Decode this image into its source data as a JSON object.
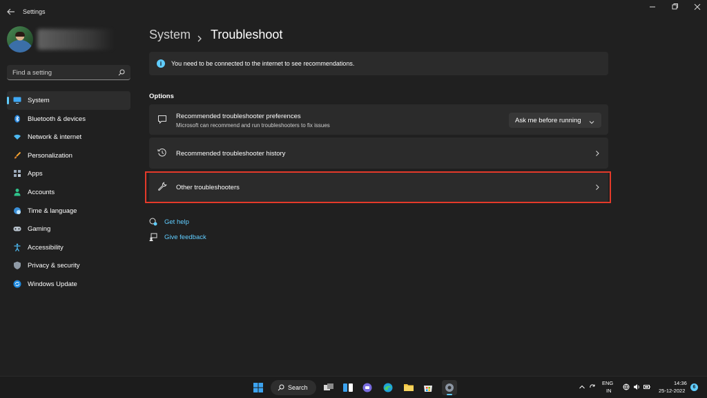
{
  "window": {
    "title": "Settings"
  },
  "sidebar": {
    "search_placeholder": "Find a setting",
    "items": [
      {
        "label": "System",
        "icon": "monitor-icon",
        "active": true
      },
      {
        "label": "Bluetooth & devices",
        "icon": "bluetooth-icon"
      },
      {
        "label": "Network & internet",
        "icon": "wifi-icon"
      },
      {
        "label": "Personalization",
        "icon": "brush-icon"
      },
      {
        "label": "Apps",
        "icon": "apps-icon"
      },
      {
        "label": "Accounts",
        "icon": "person-icon"
      },
      {
        "label": "Time & language",
        "icon": "globe-clock-icon"
      },
      {
        "label": "Gaming",
        "icon": "gamepad-icon"
      },
      {
        "label": "Accessibility",
        "icon": "accessibility-icon"
      },
      {
        "label": "Privacy & security",
        "icon": "shield-icon"
      },
      {
        "label": "Windows Update",
        "icon": "update-icon"
      }
    ]
  },
  "header": {
    "parent": "System",
    "separator": "›",
    "current": "Troubleshoot"
  },
  "info": {
    "text": "You need to be connected to the internet to see recommendations."
  },
  "options": {
    "heading": "Options",
    "preferences": {
      "title": "Recommended troubleshooter preferences",
      "subtitle": "Microsoft can recommend and run troubleshooters to fix issues",
      "dropdown_value": "Ask me before running"
    },
    "history": {
      "title": "Recommended troubleshooter history"
    },
    "other": {
      "title": "Other troubleshooters"
    }
  },
  "links": {
    "help": "Get help",
    "feedback": "Give feedback"
  },
  "taskbar": {
    "search_label": "Search",
    "lang_top": "ENG",
    "lang_bottom": "IN",
    "time": "14:36",
    "date": "25-12-2022",
    "notification_count": "6"
  },
  "colors": {
    "accent": "#60cdff",
    "highlight": "#e53a2a",
    "background": "#202020",
    "card": "#2b2b2b"
  }
}
